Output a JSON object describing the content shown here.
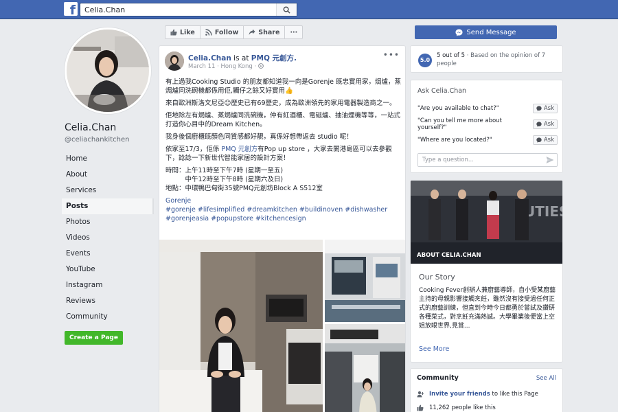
{
  "topbar": {
    "logo": "f",
    "search_value": "Celia.Chan"
  },
  "profile": {
    "name": "Celia.Chan",
    "handle": "@celiachankitchen"
  },
  "nav": {
    "items": [
      "Home",
      "About",
      "Services",
      "Posts",
      "Photos",
      "Videos",
      "Events",
      "YouTube",
      "Instagram",
      "Reviews",
      "Community"
    ],
    "active": "Posts",
    "create_page": "Create a Page"
  },
  "actions": {
    "like": "Like",
    "follow": "Follow",
    "share": "Share",
    "more": "···",
    "send_message": "Send Message"
  },
  "post": {
    "author": "Celia.Chan",
    "at_text": " is at ",
    "location": "PMQ 元創方.",
    "date": "March 11 · Hong Kong ·",
    "more": "•••",
    "p1": "有上過我Cooking Studio 的朋友都知道我一向是Gorenje 既忠實用家，焗爐，蒸焗爐同洗碗機都係用佢,觸仔之餘又好實用👍",
    "p2": "來自歐洲斯洛文尼亞😊歷史已有69歷史，成為歐洲領先的家用電器製造商之一。",
    "p3": "佢地除左有焗爐、蒸焗爐同洗碗機，仲有紅酒櫃、電磁爐、抽油煙機等等，一站式打造你心目中的Dream Kitchen。",
    "p4": "我身後個廚櫃既顏色同質感都好靚，真係好想帶返去 studio 呢！",
    "p5_a": "依家至17/3，佢係 ",
    "p5_link": "PMQ 元創方",
    "p5_b": "有Pop up store ，大家去開港島區可以去參觀下，諗諗一下新世代智能家居的設計方案！",
    "p6_l1": "時間：上午11時至下午7時 (星期一至五)",
    "p6_l2": "　　　中午12時至下午8時 (星期六及日)",
    "p6_l3": "地點：中環鴨巴甸街35號PMQ元創坊Block A S512室",
    "brand": "Gorenje",
    "tags_l1": "#gorenje #lifesimplified #dreamkitchen #buildinoven #dishwasher",
    "tags_l2": "#gorenjeasia #popupstore #kitchencesign"
  },
  "rating": {
    "badge": "5.0",
    "score": "5 out of 5",
    "text": " · Based on the opinion of 7 people"
  },
  "ask": {
    "title": "Ask Celia.Chan",
    "questions": [
      "\"Are you available to chat?\"",
      "\"Can you tell me more about yourself?\"",
      "\"Where are you located?\""
    ],
    "button": "Ask",
    "placeholder": "Type a question..."
  },
  "about": {
    "photo_label": "ABOUT CELIA.CHAN",
    "photo_text": "UTIES",
    "story_title": "Our Story",
    "story_text": "Cooking Fever創辦人兼廚藝導師，自小受某廚藝主持的母親影響接觸烹飪，雖然沒有接受過任何正式的廚藝訓練，但直到今時今日都勇於嘗試及鑽研各種菜式，對烹飪充滿熱誠。大學畢業後便當上空姐放眼世界,見賞...",
    "see_more": "See More"
  },
  "community": {
    "title": "Community",
    "see_all": "See All",
    "invite_link": "Invite your friends",
    "invite_text": " to like this Page",
    "likes": "11,262 people like this"
  }
}
